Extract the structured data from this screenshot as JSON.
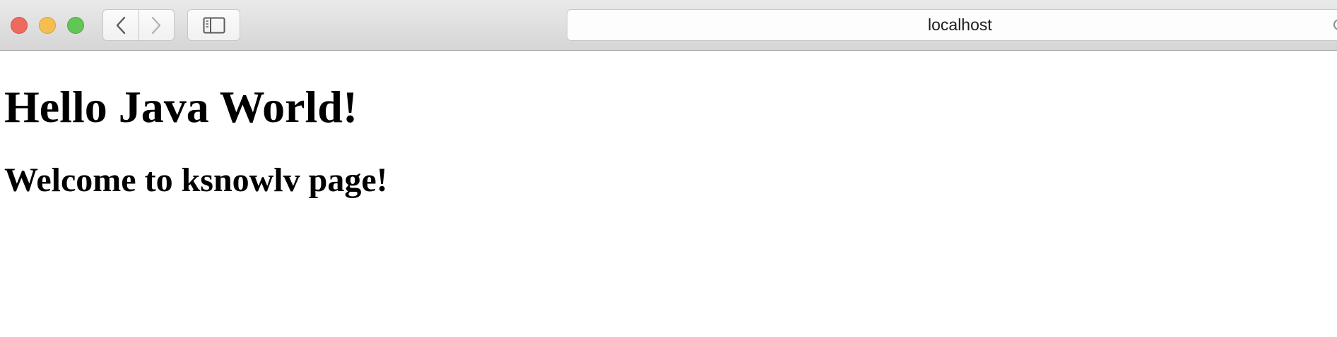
{
  "browser": {
    "address_bar": {
      "url_text": "localhost"
    },
    "icons": {
      "close": "close-window-icon",
      "minimize": "minimize-window-icon",
      "maximize": "maximize-window-icon",
      "back": "chevron-left-icon",
      "forward": "chevron-right-icon",
      "sidebar": "sidebar-icon"
    },
    "colors": {
      "close": "#ee6a5e",
      "minimize": "#f5be4f",
      "maximize": "#62c655"
    }
  },
  "page": {
    "heading": "Hello Java World!",
    "subheading": "Welcome to ksnowlv page!"
  }
}
